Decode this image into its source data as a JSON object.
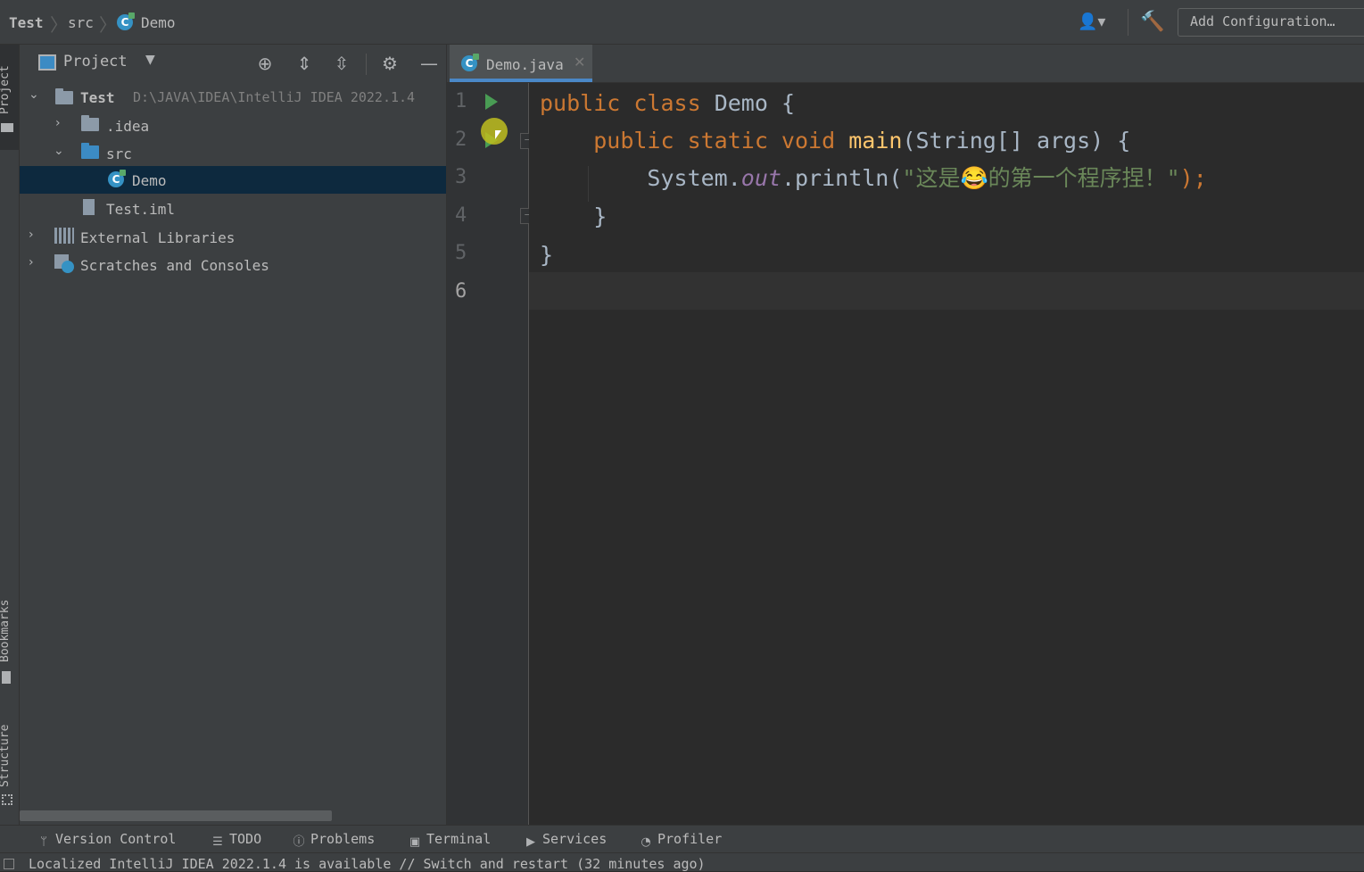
{
  "breadcrumb": {
    "project": "Test",
    "folder": "src",
    "file": "Demo"
  },
  "toolbar": {
    "add_configuration": "Add Configuration…"
  },
  "side_tabs": {
    "project": "Project",
    "bookmarks": "Bookmarks",
    "structure": "Structure"
  },
  "project_panel": {
    "title": "Project",
    "tree": [
      {
        "label": "Test",
        "path": "D:\\JAVA\\IDEA\\IntelliJ IDEA 2022.1.4"
      },
      {
        "label": ".idea"
      },
      {
        "label": "src"
      },
      {
        "label": "Demo"
      },
      {
        "label": "Test.iml"
      },
      {
        "label": "External Libraries"
      },
      {
        "label": "Scratches and Consoles"
      }
    ]
  },
  "editor": {
    "tab": "Demo.java",
    "line_numbers": [
      "1",
      "2",
      "3",
      "4",
      "5",
      "6"
    ],
    "code": {
      "l1_kw": "public class",
      "l1_name": "Demo",
      "l1_brace": "{",
      "l2_kw": "public static void",
      "l2_fn": "main",
      "l2_rest": "(String[] args) {",
      "l3_obj": "System.",
      "l3_field": "out",
      "l3_call": ".println(",
      "l3_str": "\"这是😂的第一个程序捏！\"",
      "l3_end": ");",
      "l4": "}",
      "l5": "}"
    }
  },
  "bottom_tools": [
    "Version Control",
    "TODO",
    "Problems",
    "Terminal",
    "Services",
    "Profiler"
  ],
  "status": "Localized IntelliJ IDEA 2022.1.4 is available // Switch and restart (32 minutes ago)",
  "colors": {
    "accent": "#4a88c7",
    "keyword": "#cc7832",
    "string": "#6a8759",
    "function": "#ffc66d",
    "field": "#9876aa",
    "run": "#499c54"
  }
}
